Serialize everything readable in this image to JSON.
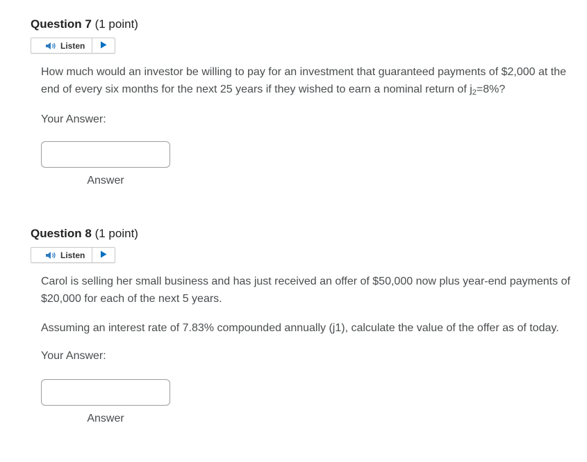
{
  "questions": [
    {
      "title": "Question 7",
      "points": "(1 point)",
      "listen_label": "Listen",
      "text_before_sub": "How much would an investor be willing to pay for an investment that guaranteed payments of $2,000 at the end of every six months for the next 25 years if they wished to earn a nominal return of j",
      "text_sub": "2",
      "text_after_sub": "=8%?",
      "answer_label": "Your Answer:",
      "answer_value": "",
      "answer_caption": "Answer"
    },
    {
      "title": "Question 8",
      "points": "(1 point)",
      "listen_label": "Listen",
      "paragraph1": "Carol is selling her small business and has just received an offer of $50,000 now plus year-end payments of $20,000 for each of the next 5 years.",
      "paragraph2": "Assuming an interest rate of 7.83% compounded annually (j1), calculate the value of the offer as of today.",
      "answer_label": "Your Answer:",
      "answer_value": "",
      "answer_caption": "Answer"
    }
  ],
  "icons": {
    "speaker": "speaker-icon",
    "play": "play-icon"
  },
  "colors": {
    "heading": "#202122",
    "body_text": "#494c4e",
    "border": "#c8c9ca",
    "play_icon": "#006fbf"
  }
}
